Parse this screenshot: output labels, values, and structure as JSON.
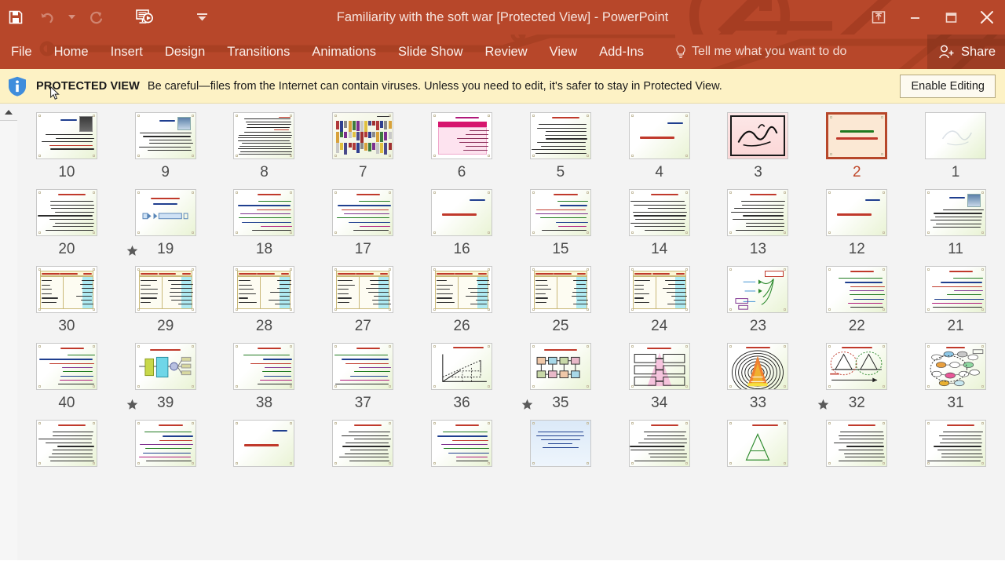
{
  "window": {
    "title": "Familiarity with the soft war [Protected View] - PowerPoint",
    "accent_color": "#b7472a",
    "quick_access": [
      {
        "name": "save-button",
        "icon": "save-icon",
        "enabled": true
      },
      {
        "name": "undo-button",
        "icon": "undo-icon",
        "enabled": false
      },
      {
        "name": "undo-dropdown",
        "icon": "chevron-down-icon",
        "enabled": false
      },
      {
        "name": "redo-button",
        "icon": "redo-icon",
        "enabled": false
      },
      {
        "name": "start-slideshow-button",
        "icon": "slideshow-icon",
        "enabled": true
      },
      {
        "name": "customize-qat-button",
        "icon": "chevron-down-icon",
        "enabled": true
      }
    ],
    "controls": [
      {
        "name": "ribbon-display-options-button",
        "icon": "ribbon-options-icon"
      },
      {
        "name": "minimize-button",
        "icon": "minimize-icon"
      },
      {
        "name": "restore-button",
        "icon": "restore-icon"
      },
      {
        "name": "close-button",
        "icon": "close-icon"
      }
    ]
  },
  "ribbon": {
    "tabs": [
      {
        "label": "File"
      },
      {
        "label": "Home"
      },
      {
        "label": "Insert"
      },
      {
        "label": "Design"
      },
      {
        "label": "Transitions"
      },
      {
        "label": "Animations"
      },
      {
        "label": "Slide Show"
      },
      {
        "label": "Review"
      },
      {
        "label": "View"
      },
      {
        "label": "Add-Ins"
      }
    ],
    "tell_me": "Tell me what you want to do",
    "share_label": "Share"
  },
  "protected_view": {
    "badge": "PROTECTED VIEW",
    "message": "Be careful—files from the Internet can contain viruses. Unless you need to edit, it's safer to stay in Protected View.",
    "button_label": "Enable Editing",
    "bar_color": "#fdf2c5"
  },
  "slide_sorter": {
    "selected_slide": 2,
    "rows": [
      {
        "slides": [
          {
            "number": "10",
            "kind": "portrait-text",
            "animated": false
          },
          {
            "number": "9",
            "kind": "portrait-text2",
            "animated": false
          },
          {
            "number": "8",
            "kind": "dense-text",
            "animated": false
          },
          {
            "number": "7",
            "kind": "colorbars",
            "animated": false
          },
          {
            "number": "6",
            "kind": "pink-table",
            "animated": false
          },
          {
            "number": "5",
            "kind": "text-page",
            "animated": false
          },
          {
            "number": "4",
            "kind": "section-title",
            "animated": false
          },
          {
            "number": "3",
            "kind": "calligraphy",
            "animated": false
          },
          {
            "number": "2",
            "kind": "title-slide",
            "animated": false,
            "selected": true
          },
          {
            "number": "1",
            "kind": "faint-art",
            "animated": false
          }
        ]
      },
      {
        "slides": [
          {
            "number": "20",
            "kind": "text-page",
            "animated": false
          },
          {
            "number": "19",
            "kind": "diagram-arrow",
            "animated": true
          },
          {
            "number": "18",
            "kind": "color-text",
            "animated": false
          },
          {
            "number": "17",
            "kind": "color-text",
            "animated": false
          },
          {
            "number": "16",
            "kind": "section-title",
            "animated": false
          },
          {
            "number": "15",
            "kind": "color-text",
            "animated": false
          },
          {
            "number": "14",
            "kind": "text-page",
            "animated": false
          },
          {
            "number": "13",
            "kind": "text-page",
            "animated": false
          },
          {
            "number": "12",
            "kind": "section-title",
            "animated": false
          },
          {
            "number": "11",
            "kind": "portrait-text2",
            "animated": false
          }
        ]
      },
      {
        "slides": [
          {
            "number": "30",
            "kind": "table-cyan",
            "animated": false
          },
          {
            "number": "29",
            "kind": "table-cyan",
            "animated": false
          },
          {
            "number": "28",
            "kind": "table-cyan",
            "animated": false
          },
          {
            "number": "27",
            "kind": "table-cyan",
            "animated": false
          },
          {
            "number": "26",
            "kind": "table-cyan",
            "animated": false
          },
          {
            "number": "25",
            "kind": "table-cyan",
            "animated": false
          },
          {
            "number": "24",
            "kind": "table-cyan",
            "animated": false
          },
          {
            "number": "23",
            "kind": "flow-green",
            "animated": false
          },
          {
            "number": "22",
            "kind": "color-text",
            "animated": false
          },
          {
            "number": "21",
            "kind": "color-text",
            "animated": false
          }
        ]
      },
      {
        "slides": [
          {
            "number": "40",
            "kind": "color-text",
            "animated": false
          },
          {
            "number": "39",
            "kind": "diagram-blocks",
            "animated": true
          },
          {
            "number": "38",
            "kind": "color-text",
            "animated": false
          },
          {
            "number": "37",
            "kind": "color-text",
            "animated": false
          },
          {
            "number": "36",
            "kind": "chart-axes",
            "animated": false
          },
          {
            "number": "35",
            "kind": "chain-boxes",
            "animated": true
          },
          {
            "number": "34",
            "kind": "pink-pyramid",
            "animated": false
          },
          {
            "number": "33",
            "kind": "rings-pyramid",
            "animated": false
          },
          {
            "number": "32",
            "kind": "triangles",
            "animated": true
          },
          {
            "number": "31",
            "kind": "network",
            "animated": false
          }
        ]
      },
      {
        "slides": [
          {
            "number": "",
            "kind": "text-page",
            "animated": false
          },
          {
            "number": "",
            "kind": "color-text",
            "animated": false
          },
          {
            "number": "",
            "kind": "section-title",
            "animated": false
          },
          {
            "number": "",
            "kind": "text-page",
            "animated": false
          },
          {
            "number": "",
            "kind": "color-text",
            "animated": false
          },
          {
            "number": "",
            "kind": "blue-slide",
            "animated": false
          },
          {
            "number": "",
            "kind": "text-page",
            "animated": false
          },
          {
            "number": "",
            "kind": "triangle-art",
            "animated": false
          },
          {
            "number": "",
            "kind": "text-page",
            "animated": false
          },
          {
            "number": "",
            "kind": "text-page",
            "animated": false
          }
        ]
      }
    ]
  }
}
